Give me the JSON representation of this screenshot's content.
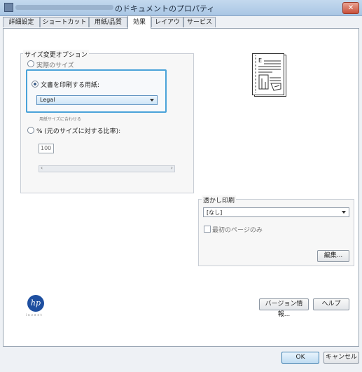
{
  "window": {
    "title": "のドキュメントのプロパティ",
    "close_glyph": "✕"
  },
  "tabs": [
    {
      "label": "詳細設定"
    },
    {
      "label": "ショートカット"
    },
    {
      "label": "用紙/品質"
    },
    {
      "label": "効果"
    },
    {
      "label": "レイアウト"
    },
    {
      "label": "サービス"
    }
  ],
  "active_tab": "効果",
  "resize_options": {
    "group_label": "サイズ変更オプション",
    "actual_size_label": "実際のサイズ",
    "print_on_paper_label": "文書を印刷する用紙:",
    "paper_select_value": "Legal",
    "fit_label": "用紙サイズに合わせる",
    "percent_label": "% (元のサイズに対する比率):",
    "percent_value": "100",
    "scroll_left": "‹",
    "scroll_right": "›",
    "selected_option": "print_on_paper"
  },
  "preview": {
    "page_letter": "E"
  },
  "watermark": {
    "group_label": "透かし印刷",
    "select_value": "[なし]",
    "first_page_only_label": "最初のページのみ",
    "first_page_only_checked": false,
    "edit_button": "編集..."
  },
  "brand": {
    "logo_text": "hp",
    "tagline": "invent"
  },
  "buttons": {
    "about": "バージョン情報...",
    "help": "ヘルプ",
    "ok": "OK",
    "cancel": "キャンセル"
  },
  "colors": {
    "highlight": "#4aa3d9",
    "hp_blue": "#1e4fa0"
  },
  "icons": {
    "select_arrow": "chevron-down-icon",
    "logo": "hp-logo-icon"
  }
}
